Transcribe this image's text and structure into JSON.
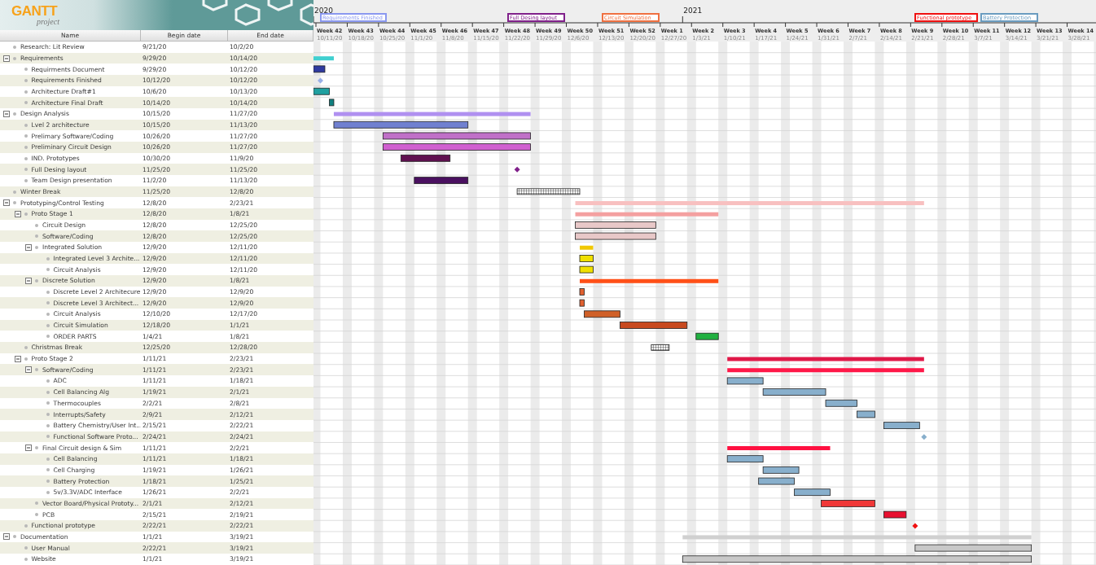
{
  "logo": {
    "title": "GANTT",
    "subtitle": "project"
  },
  "columns": [
    "Name",
    "Begin date",
    "End date"
  ],
  "timeline": {
    "years": [
      {
        "label": "2020"
      },
      {
        "label": "2021"
      }
    ],
    "weeks": [
      {
        "label": "Week 42",
        "date": "10/11/20",
        "pins": [
          {
            "text": "Requirements Finished",
            "color": "#8a98f0"
          }
        ]
      },
      {
        "label": "Week 43",
        "date": "10/18/20"
      },
      {
        "label": "Week 44",
        "date": "10/25/20"
      },
      {
        "label": "Week 45",
        "date": "11/1/20"
      },
      {
        "label": "Week 46",
        "date": "11/8/20"
      },
      {
        "label": "Week 47",
        "date": "11/15/20"
      },
      {
        "label": "Week 48",
        "date": "11/22/20",
        "pins": [
          {
            "text": "Full Desing layout",
            "color": "#80208a"
          }
        ]
      },
      {
        "label": "Week 49",
        "date": "11/29/20"
      },
      {
        "label": "Week 50",
        "date": "12/6/20"
      },
      {
        "label": "Week 51",
        "date": "12/13/20",
        "pins": [
          {
            "text": "Circuit Simulation",
            "color": "#f07040"
          }
        ]
      },
      {
        "label": "Week 52",
        "date": "12/20/20"
      },
      {
        "label": "Week 1",
        "date": "12/27/20"
      },
      {
        "label": "Week 2",
        "date": "1/3/21"
      },
      {
        "label": "Week 3",
        "date": "1/10/21"
      },
      {
        "label": "Week 4",
        "date": "1/17/21"
      },
      {
        "label": "Week 5",
        "date": "1/24/21"
      },
      {
        "label": "Week 6",
        "date": "1/31/21"
      },
      {
        "label": "Week 7",
        "date": "2/7/21"
      },
      {
        "label": "Week 8",
        "date": "2/14/21"
      },
      {
        "label": "Week 9",
        "date": "2/21/21",
        "pins": [
          {
            "text": "Functional prototype",
            "color": "#f01010"
          },
          {
            "text": "Battery Protection",
            "color": "#6a9cc0"
          }
        ]
      },
      {
        "label": "Week 10",
        "date": "2/28/21"
      },
      {
        "label": "Week 11",
        "date": "3/7/21"
      },
      {
        "label": "Week 12",
        "date": "3/14/21"
      },
      {
        "label": "Week 13",
        "date": "3/21/21"
      },
      {
        "label": "Week 14",
        "date": "3/28/21"
      }
    ]
  },
  "tasks": [
    {
      "name": "Research: Lit Review",
      "begin": "9/21/20",
      "end": "10/2/20"
    },
    {
      "name": "Requirements",
      "begin": "9/29/20",
      "end": "10/14/20",
      "kind": "summary",
      "color": "#40d0d0",
      "expanded": true,
      "children": [
        {
          "name": "Requirments Document",
          "begin": "9/29/20",
          "end": "10/12/20",
          "kind": "task",
          "color": "#2f3aa0"
        },
        {
          "name": "Requirements Finished",
          "begin": "10/12/20",
          "end": "10/12/20",
          "kind": "milestone",
          "color": "#9ab0e8"
        },
        {
          "name": "Architecture Draft#1",
          "begin": "10/6/20",
          "end": "10/13/20",
          "kind": "task",
          "color": "#20a0a0"
        },
        {
          "name": "Architecture Final Draft",
          "begin": "10/14/20",
          "end": "10/14/20",
          "kind": "task",
          "color": "#108080"
        }
      ]
    },
    {
      "name": "Design Analysis",
      "begin": "10/15/20",
      "end": "11/27/20",
      "kind": "summary",
      "color": "#b090f0",
      "expanded": true,
      "children": [
        {
          "name": "Lvel 2 architecture",
          "begin": "10/15/20",
          "end": "11/13/20",
          "kind": "task",
          "color": "#7080d0"
        },
        {
          "name": "Prelimary Software/Coding",
          "begin": "10/26/20",
          "end": "11/27/20",
          "kind": "task",
          "color": "#c070c8"
        },
        {
          "name": "Preliminary Circuit Design",
          "begin": "10/26/20",
          "end": "11/27/20",
          "kind": "task",
          "color": "#d060d0"
        },
        {
          "name": "IND. Prototypes",
          "begin": "10/30/20",
          "end": "11/9/20",
          "kind": "task",
          "color": "#601050"
        },
        {
          "name": "Full Desing layout",
          "begin": "11/25/20",
          "end": "11/25/20",
          "kind": "milestone",
          "color": "#80208a"
        },
        {
          "name": "Team Design presentation",
          "begin": "11/2/20",
          "end": "11/13/20",
          "kind": "task",
          "color": "#4a1060"
        }
      ]
    },
    {
      "name": "Winter Break",
      "begin": "11/25/20",
      "end": "12/8/20",
      "kind": "holiday"
    },
    {
      "name": "Prototyping/Control Testing",
      "begin": "12/8/20",
      "end": "2/23/21",
      "kind": "summary",
      "color": "#f8c0c0",
      "expanded": true,
      "children": [
        {
          "name": "Proto Stage 1",
          "begin": "12/8/20",
          "end": "1/8/21",
          "kind": "summary",
          "color": "#f4a0a0",
          "expanded": true,
          "children": [
            {
              "name": "Circuit Design",
              "begin": "12/8/20",
              "end": "12/25/20",
              "kind": "task",
              "color": "#e8c8c8"
            },
            {
              "name": "Software/Coding",
              "begin": "12/8/20",
              "end": "12/25/20",
              "kind": "task",
              "color": "#e8c8c8"
            },
            {
              "name": "Integrated Solution",
              "begin": "12/9/20",
              "end": "12/11/20",
              "kind": "summary",
              "color": "#f0c800",
              "expanded": true,
              "children": [
                {
                  "name": "Integrated Level 3 Archite...",
                  "begin": "12/9/20",
                  "end": "12/11/20",
                  "kind": "task",
                  "color": "#f0e000"
                },
                {
                  "name": "Circuit Analysis",
                  "begin": "12/9/20",
                  "end": "12/11/20",
                  "kind": "task",
                  "color": "#f0e000"
                }
              ]
            },
            {
              "name": "Discrete Solution",
              "begin": "12/9/20",
              "end": "1/8/21",
              "kind": "summary",
              "color": "#ff5018",
              "expanded": true,
              "children": [
                {
                  "name": "Discrete Level 2 Architecure",
                  "begin": "12/9/20",
                  "end": "12/9/20",
                  "kind": "task",
                  "color": "#e06030"
                },
                {
                  "name": "Discrete Level 3 Architect...",
                  "begin": "12/9/20",
                  "end": "12/9/20",
                  "kind": "task",
                  "color": "#e06030"
                },
                {
                  "name": "Circuit Analysis",
                  "begin": "12/10/20",
                  "end": "12/17/20",
                  "kind": "task",
                  "color": "#d06028"
                },
                {
                  "name": "Circuit Simulation",
                  "begin": "12/18/20",
                  "end": "1/1/21",
                  "kind": "task",
                  "color": "#c84a20"
                },
                {
                  "name": "ORDER PARTS",
                  "begin": "1/4/21",
                  "end": "1/8/21",
                  "kind": "task",
                  "color": "#20b040"
                }
              ]
            }
          ]
        },
        {
          "name": "Christmas Break",
          "begin": "12/25/20",
          "end": "12/28/20",
          "kind": "holiday"
        },
        {
          "name": "Proto Stage 2",
          "begin": "1/11/21",
          "end": "2/23/21",
          "kind": "summary",
          "color": "#e01848",
          "expanded": true,
          "children": [
            {
              "name": "Software/Coding",
              "begin": "1/11/21",
              "end": "2/23/21",
              "kind": "summary",
              "color": "#ff1848",
              "expanded": true,
              "children": [
                {
                  "name": "ADC",
                  "begin": "1/11/21",
                  "end": "1/18/21",
                  "kind": "task",
                  "color": "#88afcc"
                },
                {
                  "name": "Cell Balancing Alg",
                  "begin": "1/19/21",
                  "end": "2/1/21",
                  "kind": "task",
                  "color": "#88afcc"
                },
                {
                  "name": "Thermocouples",
                  "begin": "2/2/21",
                  "end": "2/8/21",
                  "kind": "task",
                  "color": "#88afcc"
                },
                {
                  "name": "Interrupts/Safety",
                  "begin": "2/9/21",
                  "end": "2/12/21",
                  "kind": "task",
                  "color": "#88afcc"
                },
                {
                  "name": "Battery Chemistry/User Int...",
                  "begin": "2/15/21",
                  "end": "2/22/21",
                  "kind": "task",
                  "color": "#88afcc"
                },
                {
                  "name": "Functional Software Proto...",
                  "begin": "2/24/21",
                  "end": "2/24/21",
                  "kind": "milestone",
                  "color": "#88afcc"
                }
              ]
            },
            {
              "name": "Final Circuit design & Sim",
              "begin": "1/11/21",
              "end": "2/2/21",
              "kind": "summary",
              "color": "#ff1040",
              "expanded": true,
              "children": [
                {
                  "name": "Cell Balancing",
                  "begin": "1/11/21",
                  "end": "1/18/21",
                  "kind": "task",
                  "color": "#88afcc"
                },
                {
                  "name": "Cell Charging",
                  "begin": "1/19/21",
                  "end": "1/26/21",
                  "kind": "task",
                  "color": "#88afcc"
                },
                {
                  "name": "Battery Protection",
                  "begin": "1/18/21",
                  "end": "1/25/21",
                  "kind": "task",
                  "color": "#88afcc"
                },
                {
                  "name": "5v/3.3V/ADC Interface",
                  "begin": "1/26/21",
                  "end": "2/2/21",
                  "kind": "task",
                  "color": "#88afcc"
                }
              ]
            },
            {
              "name": "Vector Board/Physical Prototy...",
              "begin": "2/1/21",
              "end": "2/12/21",
              "kind": "task",
              "color": "#f03838"
            },
            {
              "name": "PCB",
              "begin": "2/15/21",
              "end": "2/19/21",
              "kind": "task",
              "color": "#e81030"
            }
          ]
        },
        {
          "name": "Functional prototype",
          "begin": "2/22/21",
          "end": "2/22/21",
          "kind": "milestone",
          "color": "#f01010"
        }
      ]
    },
    {
      "name": "Documentation",
      "begin": "1/1/21",
      "end": "3/19/21",
      "kind": "summary",
      "color": "#d0d0d0",
      "expanded": true,
      "children": [
        {
          "name": "User Manual",
          "begin": "2/22/21",
          "end": "3/19/21",
          "kind": "task",
          "color": "#c8c8c8"
        },
        {
          "name": "Website",
          "begin": "1/1/21",
          "end": "3/19/21",
          "kind": "task",
          "color": "#c8c8c8"
        }
      ]
    }
  ]
}
